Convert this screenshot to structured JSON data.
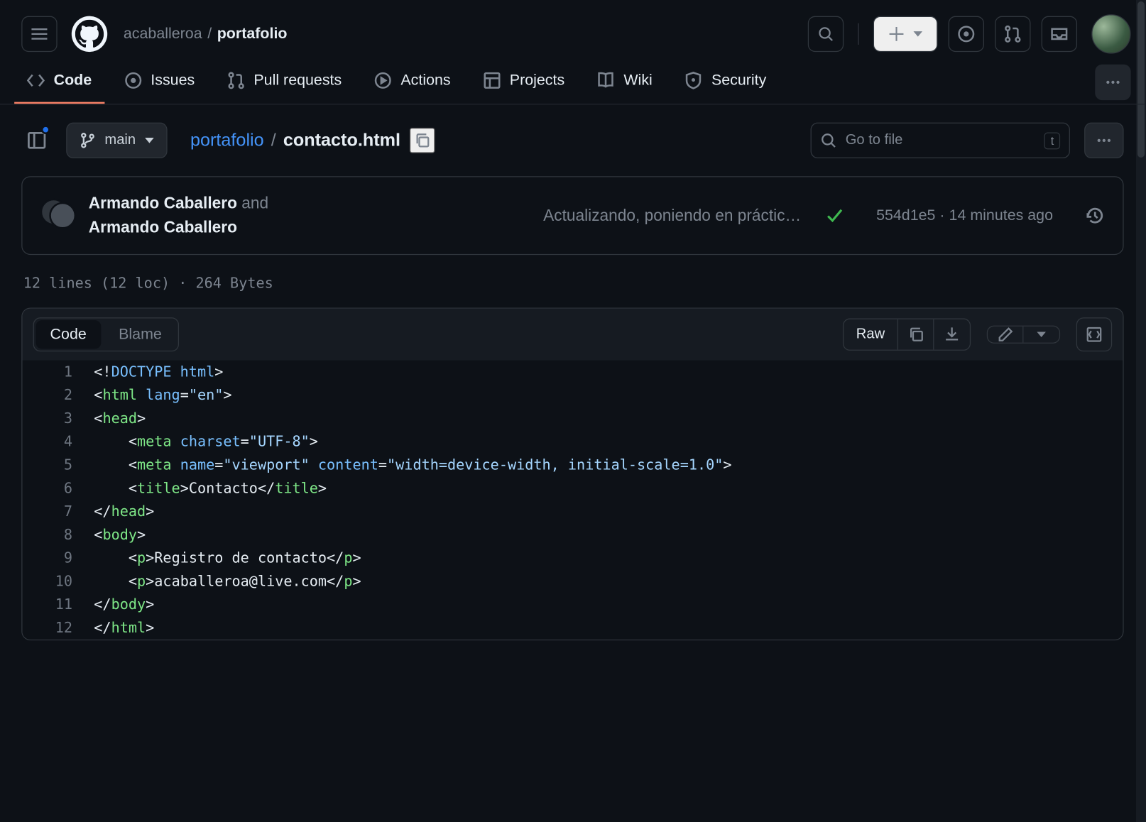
{
  "header": {
    "owner": "acaballeroa",
    "repo": "portafolio"
  },
  "tabs": {
    "code": "Code",
    "issues": "Issues",
    "pulls": "Pull requests",
    "actions": "Actions",
    "projects": "Projects",
    "wiki": "Wiki",
    "security": "Security"
  },
  "branch": {
    "name": "main"
  },
  "path": {
    "repo": "portafolio",
    "file": "contacto.html"
  },
  "search": {
    "placeholder": "Go to file",
    "kbd": "t"
  },
  "commit": {
    "author1": "Armando Caballero",
    "and": "and",
    "author2": "Armando Caballero",
    "message": "Actualizando, poniendo en práctic…",
    "sha": "554d1e5",
    "sep": "·",
    "time": "14 minutes ago"
  },
  "stats": "12 lines (12 loc) · 264 Bytes",
  "viewtabs": {
    "code": "Code",
    "blame": "Blame",
    "raw": "Raw"
  },
  "lines": [
    {
      "n": 1,
      "html": "<span class='pl-ang'>&lt;!</span><span class='pl-c1'>DOCTYPE html</span><span class='pl-ang'>&gt;</span>"
    },
    {
      "n": 2,
      "html": "<span class='pl-ang'>&lt;</span><span class='pl-ent'>html</span> <span class='pl-e'>lang</span>=<span class='pl-s'>\"en\"</span><span class='pl-ang'>&gt;</span>"
    },
    {
      "n": 3,
      "html": "<span class='pl-ang'>&lt;</span><span class='pl-ent'>head</span><span class='pl-ang'>&gt;</span>"
    },
    {
      "n": 4,
      "html": "    <span class='pl-ang'>&lt;</span><span class='pl-ent'>meta</span> <span class='pl-e'>charset</span>=<span class='pl-s'>\"UTF-8\"</span><span class='pl-ang'>&gt;</span>"
    },
    {
      "n": 5,
      "html": "    <span class='pl-ang'>&lt;</span><span class='pl-ent'>meta</span> <span class='pl-e'>name</span>=<span class='pl-s'>\"viewport\"</span> <span class='pl-e'>content</span>=<span class='pl-s'>\"width=device-width, initial-scale=1.0\"</span><span class='pl-ang'>&gt;</span>"
    },
    {
      "n": 6,
      "html": "    <span class='pl-ang'>&lt;</span><span class='pl-ent'>title</span><span class='pl-ang'>&gt;</span><span class='pl-txt'>Contacto</span><span class='pl-ang'>&lt;/</span><span class='pl-ent'>title</span><span class='pl-ang'>&gt;</span>"
    },
    {
      "n": 7,
      "html": "<span class='pl-ang'>&lt;/</span><span class='pl-ent'>head</span><span class='pl-ang'>&gt;</span>"
    },
    {
      "n": 8,
      "html": "<span class='pl-ang'>&lt;</span><span class='pl-ent'>body</span><span class='pl-ang'>&gt;</span>"
    },
    {
      "n": 9,
      "html": "    <span class='pl-ang'>&lt;</span><span class='pl-ent'>p</span><span class='pl-ang'>&gt;</span><span class='pl-txt'>Registro de contacto</span><span class='pl-ang'>&lt;/</span><span class='pl-ent'>p</span><span class='pl-ang'>&gt;</span>"
    },
    {
      "n": 10,
      "html": "    <span class='pl-ang'>&lt;</span><span class='pl-ent'>p</span><span class='pl-ang'>&gt;</span><span class='pl-txt'>acaballeroa@live.com</span><span class='pl-ang'>&lt;/</span><span class='pl-ent'>p</span><span class='pl-ang'>&gt;</span>"
    },
    {
      "n": 11,
      "html": "<span class='pl-ang'>&lt;/</span><span class='pl-ent'>body</span><span class='pl-ang'>&gt;</span>"
    },
    {
      "n": 12,
      "html": "<span class='pl-ang'>&lt;/</span><span class='pl-ent'>html</span><span class='pl-ang'>&gt;</span>"
    }
  ]
}
